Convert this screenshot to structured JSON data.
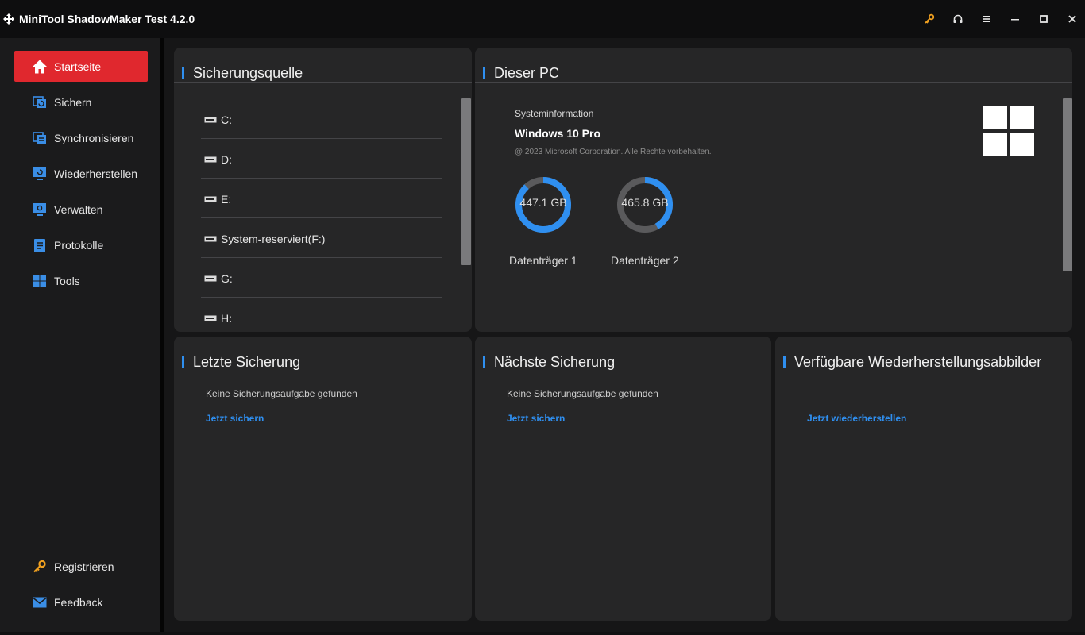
{
  "app": {
    "title": "MiniTool ShadowMaker Test 4.2.0",
    "accent": "#2f8ff0",
    "active_color": "#e0282e"
  },
  "sidebar": {
    "items": [
      {
        "label": "Startseite",
        "icon": "home-icon"
      },
      {
        "label": "Sichern",
        "icon": "backup-icon"
      },
      {
        "label": "Synchronisieren",
        "icon": "sync-icon"
      },
      {
        "label": "Wiederherstellen",
        "icon": "restore-icon"
      },
      {
        "label": "Verwalten",
        "icon": "manage-icon"
      },
      {
        "label": "Protokolle",
        "icon": "logs-icon"
      },
      {
        "label": "Tools",
        "icon": "tools-icon"
      }
    ],
    "bottom": [
      {
        "label": "Registrieren",
        "icon": "key-icon"
      },
      {
        "label": "Feedback",
        "icon": "mail-icon"
      }
    ]
  },
  "source": {
    "title": "Sicherungsquelle",
    "drives": [
      "C:",
      "D:",
      "E:",
      "System-reserviert(F:)",
      "G:",
      "H:"
    ]
  },
  "pc": {
    "title": "Dieser PC",
    "sys_label": "Systeminformation",
    "os": "Windows 10 Pro",
    "copyright": "@ 2023 Microsoft Corporation. Alle Rechte vorbehalten.",
    "disks": [
      {
        "size": "447.1 GB",
        "label": "Datenträger 1",
        "used_fraction": 0.88
      },
      {
        "size": "465.8 GB",
        "label": "Datenträger 2",
        "used_fraction": 0.42
      }
    ]
  },
  "last_backup": {
    "title": "Letzte Sicherung",
    "text": "Keine Sicherungsaufgabe gefunden",
    "link": "Jetzt sichern"
  },
  "next_backup": {
    "title": "Nächste Sicherung",
    "text": "Keine Sicherungsaufgabe gefunden",
    "link": "Jetzt sichern"
  },
  "images": {
    "title": "Verfügbare Wiederherstellungsabbilder",
    "link": "Jetzt wiederherstellen"
  }
}
